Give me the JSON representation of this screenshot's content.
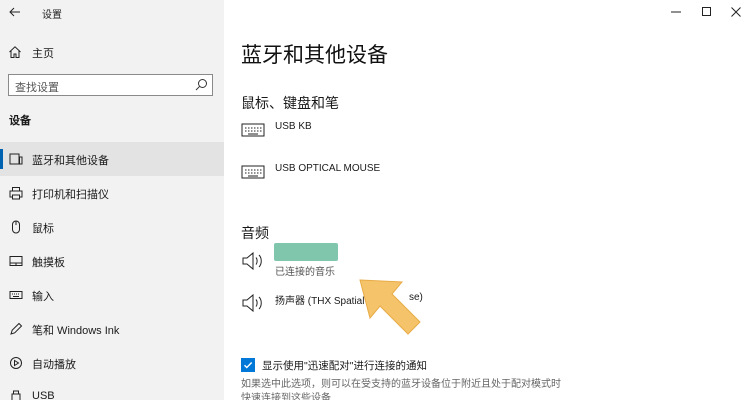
{
  "window": {
    "app_title": "设置"
  },
  "left": {
    "home_label": "主页",
    "search_placeholder": "查找设置",
    "section_label": "设备",
    "nav": [
      {
        "label": "蓝牙和其他设备",
        "icon": "bluetooth-devices-icon",
        "active": true
      },
      {
        "label": "打印机和扫描仪",
        "icon": "printer-icon"
      },
      {
        "label": "鼠标",
        "icon": "mouse-icon"
      },
      {
        "label": "触摸板",
        "icon": "touchpad-icon"
      },
      {
        "label": "输入",
        "icon": "keyboard-icon"
      },
      {
        "label": "笔和 Windows Ink",
        "icon": "pen-icon"
      },
      {
        "label": "自动播放",
        "icon": "autoplay-icon"
      },
      {
        "label": "USB",
        "icon": "usb-icon"
      }
    ]
  },
  "main": {
    "title": "蓝牙和其他设备",
    "groups": {
      "input_title": "鼠标、键盘和笔",
      "audio_title": "音频"
    },
    "input_devices": [
      {
        "name": "USB KB",
        "icon": "keyboard-icon"
      },
      {
        "name": "USB OPTICAL MOUSE",
        "icon": "keyboard-icon"
      }
    ],
    "audio_devices": [
      {
        "name": "",
        "status": "已连接的音乐",
        "icon": "speaker-icon"
      },
      {
        "name": "扬声器 (THX Spatial",
        "name_tail": "se)",
        "icon": "speaker-icon"
      }
    ],
    "swift_pair_label": "显示使用\"迅速配对\"进行连接的通知",
    "swift_pair_checked": true,
    "description_line1": "如果选中此选项，则可以在受支持的蓝牙设备位于附近且处于配对模式时",
    "description_line2": "快速连接到这些设备"
  },
  "colors": {
    "accent": "#0078d7",
    "redaction": "#7fc6ad",
    "arrow": "#f5c36a"
  }
}
